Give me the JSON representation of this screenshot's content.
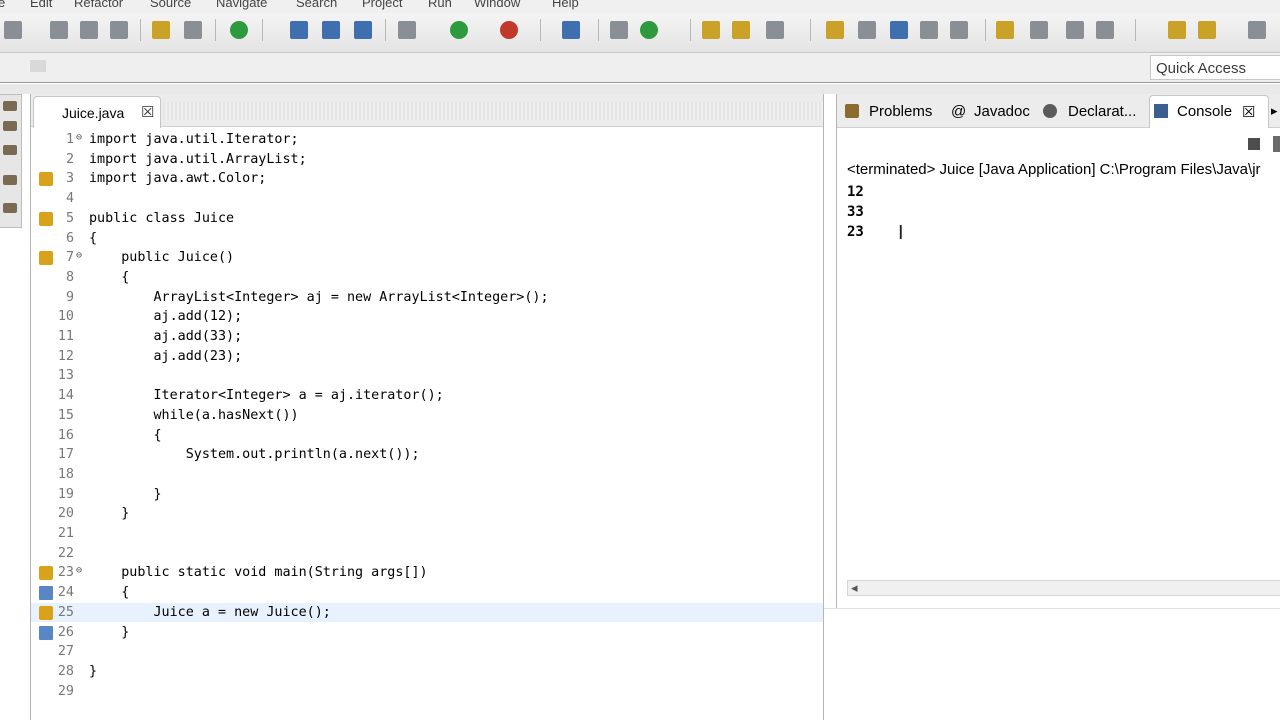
{
  "menubar": {
    "items": [
      "e",
      "Edit",
      "Refactor",
      "Source",
      "Navigate",
      "Search",
      "Project",
      "Run",
      "Window",
      "Help"
    ]
  },
  "quick_access": {
    "placeholder": "Quick Access"
  },
  "editor": {
    "tab": {
      "label": "Juice.java",
      "close": "☒"
    },
    "current_line": 25,
    "lines": [
      {
        "n": "1",
        "fold": "⊖",
        "text": "import java.util.Iterator;"
      },
      {
        "n": "2",
        "text": "import java.util.ArrayList;"
      },
      {
        "n": "3",
        "marker": "warn",
        "text": "import java.awt.Color;"
      },
      {
        "n": "4",
        "text": ""
      },
      {
        "n": "5",
        "marker": "warn",
        "text": "public class Juice"
      },
      {
        "n": "6",
        "text": "{"
      },
      {
        "n": "7",
        "marker": "warn",
        "fold": "⊖",
        "text": "    public Juice()"
      },
      {
        "n": "8",
        "text": "    {"
      },
      {
        "n": "9",
        "text": "        ArrayList<Integer> aj = new ArrayList<Integer>();"
      },
      {
        "n": "10",
        "text": "        aj.add(12);"
      },
      {
        "n": "11",
        "text": "        aj.add(33);"
      },
      {
        "n": "12",
        "text": "        aj.add(23);"
      },
      {
        "n": "13",
        "text": ""
      },
      {
        "n": "14",
        "text": "        Iterator<Integer> a = aj.iterator();"
      },
      {
        "n": "15",
        "text": "        while(a.hasNext())"
      },
      {
        "n": "16",
        "text": "        {"
      },
      {
        "n": "17",
        "text": "            System.out.println(a.next());"
      },
      {
        "n": "18",
        "text": ""
      },
      {
        "n": "19",
        "text": "        }"
      },
      {
        "n": "20",
        "text": "    }"
      },
      {
        "n": "21",
        "text": ""
      },
      {
        "n": "22",
        "text": ""
      },
      {
        "n": "23",
        "marker": "warn",
        "fold": "⊖",
        "text": "    public static void main(String args[])"
      },
      {
        "n": "24",
        "marker": "bp",
        "text": "    {"
      },
      {
        "n": "25",
        "marker": "warn",
        "text": "        Juice a = new Juice();"
      },
      {
        "n": "26",
        "marker": "bp",
        "text": "    }"
      },
      {
        "n": "27",
        "text": ""
      },
      {
        "n": "28",
        "text": "}"
      },
      {
        "n": "29",
        "text": ""
      }
    ]
  },
  "console_panel": {
    "tabs": [
      {
        "label": "Problems",
        "icon": "problems-icon"
      },
      {
        "label": "Javadoc",
        "icon": "at-icon"
      },
      {
        "label": "Declarat...",
        "icon": "declaration-icon"
      },
      {
        "label": "Console",
        "icon": "console-icon",
        "active": true
      }
    ],
    "terminated": "<terminated> Juice [Java Application] C:\\Program Files\\Java\\jr",
    "output": [
      "12",
      "33",
      "23"
    ],
    "scroll_arrow": "◂"
  }
}
